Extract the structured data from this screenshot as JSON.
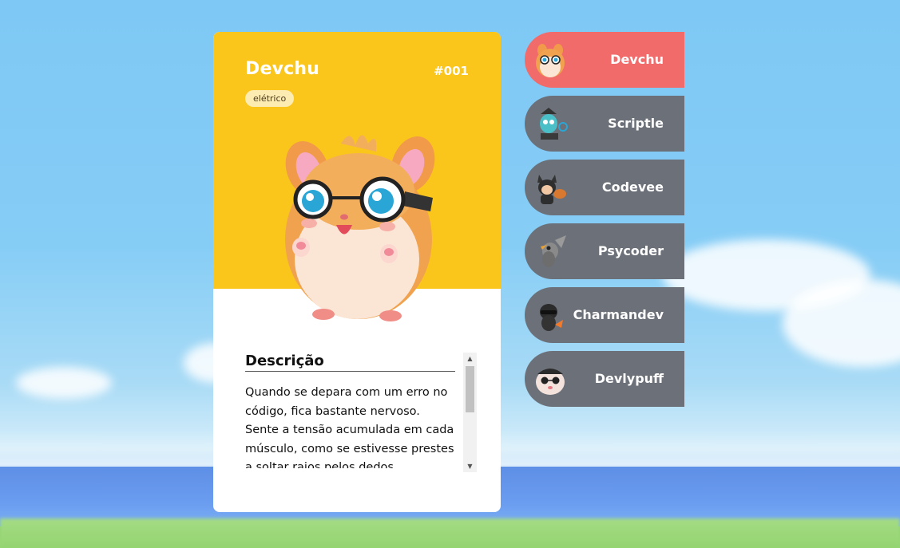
{
  "card": {
    "name": "Devchu",
    "number": "#001",
    "type": "elétrico",
    "colors": {
      "top": "#fbc61c",
      "badge": "#fdecb2"
    },
    "description": {
      "title": "Descrição",
      "text": "Quando se depara com um erro no código, fica bastante nervoso. Sente a tensão acumulada em cada músculo, como se estivesse prestes a soltar raios pelos dedos"
    }
  },
  "characters": [
    {
      "label": "Devchu",
      "active": true,
      "icon": "hamster-avatar-icon"
    },
    {
      "label": "Scriptle",
      "active": false,
      "icon": "robot-creature-avatar-icon"
    },
    {
      "label": "Codevee",
      "active": false,
      "icon": "fox-creature-avatar-icon"
    },
    {
      "label": "Psycoder",
      "active": false,
      "icon": "bird-creature-avatar-icon"
    },
    {
      "label": "Charmandev",
      "active": false,
      "icon": "lizard-creature-avatar-icon"
    },
    {
      "label": "Devlypuff",
      "active": false,
      "icon": "puffball-avatar-icon"
    }
  ],
  "colors": {
    "active_item": "#f26b6b",
    "inactive_item": "#6c7079"
  }
}
